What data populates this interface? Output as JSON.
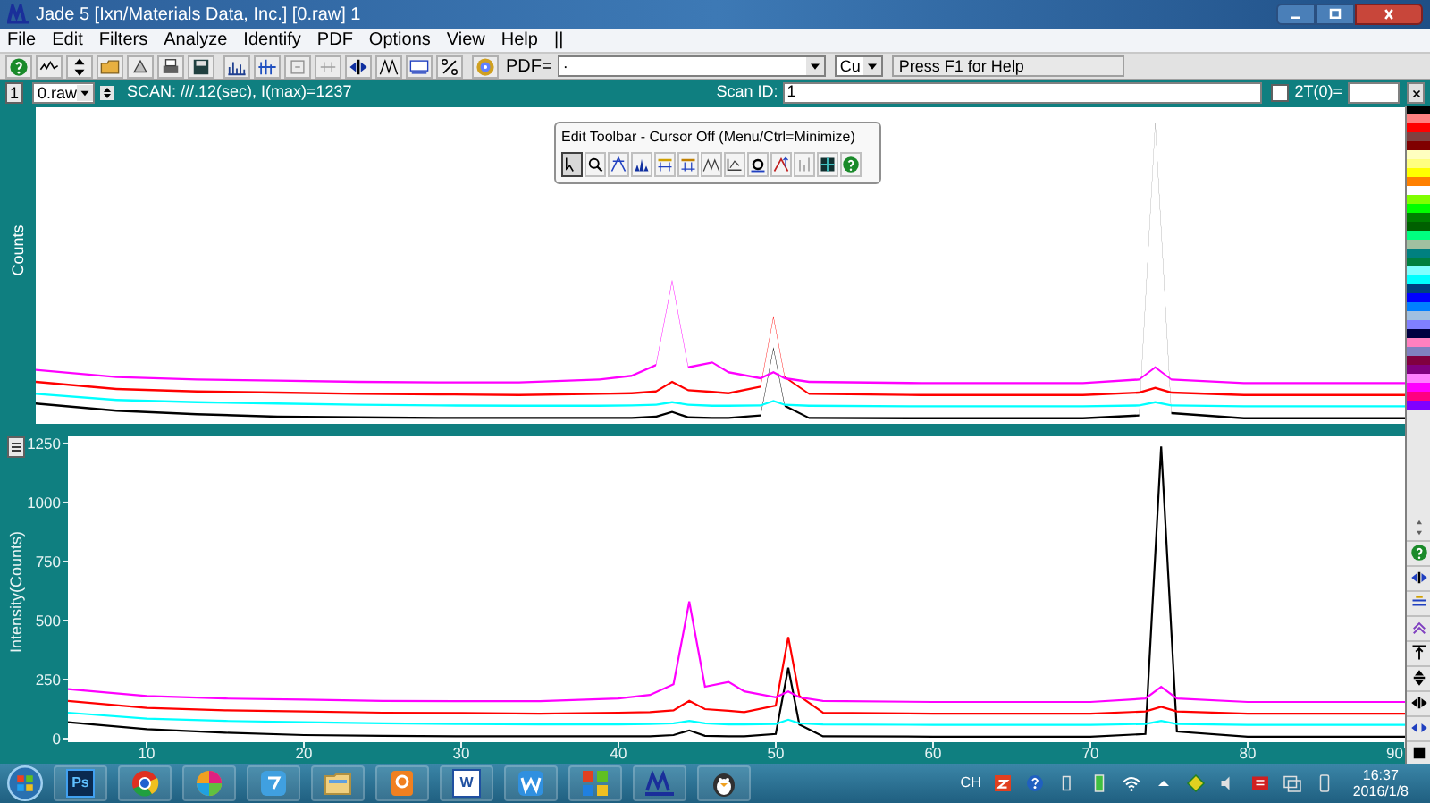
{
  "window": {
    "title": "Jade 5 [Ixn/Materials Data, Inc.]  [0.raw] 1"
  },
  "menu": [
    "File",
    "Edit",
    "Filters",
    "Analyze",
    "Identify",
    "PDF",
    "Options",
    "View",
    "Help",
    "||"
  ],
  "toolbar": {
    "pdf_label": "PDF=",
    "pdf_value": "·",
    "radiation": "Cu",
    "hint": "Press F1 for Help"
  },
  "scan_bar": {
    "pane": "1",
    "file": "0.raw",
    "info": "SCAN: ///.12(sec), I(max)=1237",
    "scan_id_label": "Scan ID:",
    "scan_id": "1",
    "two_theta_checked": false,
    "two_theta_label": "2T(0)="
  },
  "overview": {
    "ylabel": "Counts"
  },
  "main_chart": {
    "chart_data": {
      "type": "line",
      "ylabel": "Intensity(Counts)",
      "x": [
        5,
        10,
        15,
        20,
        25,
        30,
        35,
        40,
        42,
        43.5,
        44.5,
        45.5,
        47,
        48,
        50,
        50.8,
        51.5,
        53,
        60,
        70,
        73.5,
        74.5,
        75.5,
        80,
        85,
        90
      ],
      "series": [
        {
          "color": "#000000",
          "values": [
            70,
            40,
            25,
            15,
            12,
            10,
            10,
            10,
            10,
            15,
            35,
            12,
            10,
            10,
            20,
            300,
            60,
            10,
            8,
            8,
            20,
            1237,
            30,
            8,
            8,
            8
          ]
        },
        {
          "color": "#00ffff",
          "values": [
            110,
            85,
            75,
            70,
            65,
            62,
            60,
            60,
            62,
            65,
            75,
            65,
            60,
            60,
            62,
            80,
            65,
            60,
            58,
            58,
            62,
            75,
            62,
            58,
            58,
            58
          ]
        },
        {
          "color": "#ff0000",
          "values": [
            160,
            130,
            120,
            115,
            110,
            108,
            105,
            110,
            112,
            120,
            160,
            125,
            118,
            112,
            140,
            430,
            180,
            110,
            105,
            105,
            115,
            135,
            115,
            105,
            105,
            105
          ]
        },
        {
          "color": "#ff00ff",
          "values": [
            210,
            180,
            170,
            165,
            160,
            158,
            158,
            170,
            185,
            230,
            580,
            220,
            240,
            200,
            175,
            200,
            175,
            160,
            155,
            155,
            170,
            220,
            170,
            155,
            155,
            155
          ]
        }
      ],
      "xlim": [
        5,
        90
      ],
      "ylim": [
        0,
        1280
      ],
      "xticks": [
        10,
        20,
        30,
        40,
        50,
        60,
        70,
        80,
        90
      ],
      "yticks": [
        0,
        250,
        500,
        750,
        1000,
        1250
      ]
    }
  },
  "edit_toolbar": {
    "title": "Edit Toolbar - Cursor Off (Menu/Ctrl=Minimize)",
    "buttons": [
      {
        "selected": true
      },
      {
        "selected": false
      },
      {
        "selected": false
      },
      {
        "selected": false
      },
      {
        "selected": false
      },
      {
        "selected": false
      },
      {
        "selected": false
      },
      {
        "selected": false
      },
      {
        "selected": false
      },
      {
        "selected": false
      },
      {
        "selected": false
      },
      {
        "selected": false
      },
      {
        "selected": false
      }
    ]
  },
  "palette": [
    {
      "color": "#000000"
    },
    {
      "color": "#ff8080"
    },
    {
      "color": "#ff0000"
    },
    {
      "color": "#804040"
    },
    {
      "color": "#800000"
    },
    {
      "color": "#ffffc0"
    },
    {
      "color": "#ffff80"
    },
    {
      "color": "#ffff00"
    },
    {
      "color": "#ff8000"
    },
    {
      "color": "#ffffff"
    },
    {
      "color": "#80ff00"
    },
    {
      "color": "#00ff00"
    },
    {
      "color": "#008000"
    },
    {
      "color": "#006000"
    },
    {
      "color": "#00ff80"
    },
    {
      "color": "#a0c0a0"
    },
    {
      "color": "#008080"
    },
    {
      "color": "#008040"
    },
    {
      "color": "#80ffff"
    },
    {
      "color": "#00ffff"
    },
    {
      "color": "#004080"
    },
    {
      "color": "#0000ff"
    },
    {
      "color": "#0080ff"
    },
    {
      "color": "#a0c0e0"
    },
    {
      "color": "#8080ff"
    },
    {
      "color": "#000040"
    },
    {
      "color": "#ff80c0"
    },
    {
      "color": "#8080c0"
    },
    {
      "color": "#800040"
    },
    {
      "color": "#800080"
    },
    {
      "color": "#ff80ff"
    },
    {
      "color": "#ff00ff"
    },
    {
      "color": "#ff0080"
    },
    {
      "color": "#8000ff"
    }
  ],
  "taskbar": {
    "apps": [
      {
        "kind": "photoshop",
        "label": "Ps"
      },
      {
        "kind": "browser"
      },
      {
        "kind": "pinwheel"
      },
      {
        "kind": "chat"
      },
      {
        "kind": "folder"
      },
      {
        "kind": "pdf"
      },
      {
        "kind": "word",
        "label": "W"
      },
      {
        "kind": "writer"
      },
      {
        "kind": "tiles"
      },
      {
        "kind": "jade"
      },
      {
        "kind": "penguin"
      }
    ],
    "tray": {
      "language": "CH",
      "time": "16:37",
      "date": "2016/1/8"
    }
  }
}
